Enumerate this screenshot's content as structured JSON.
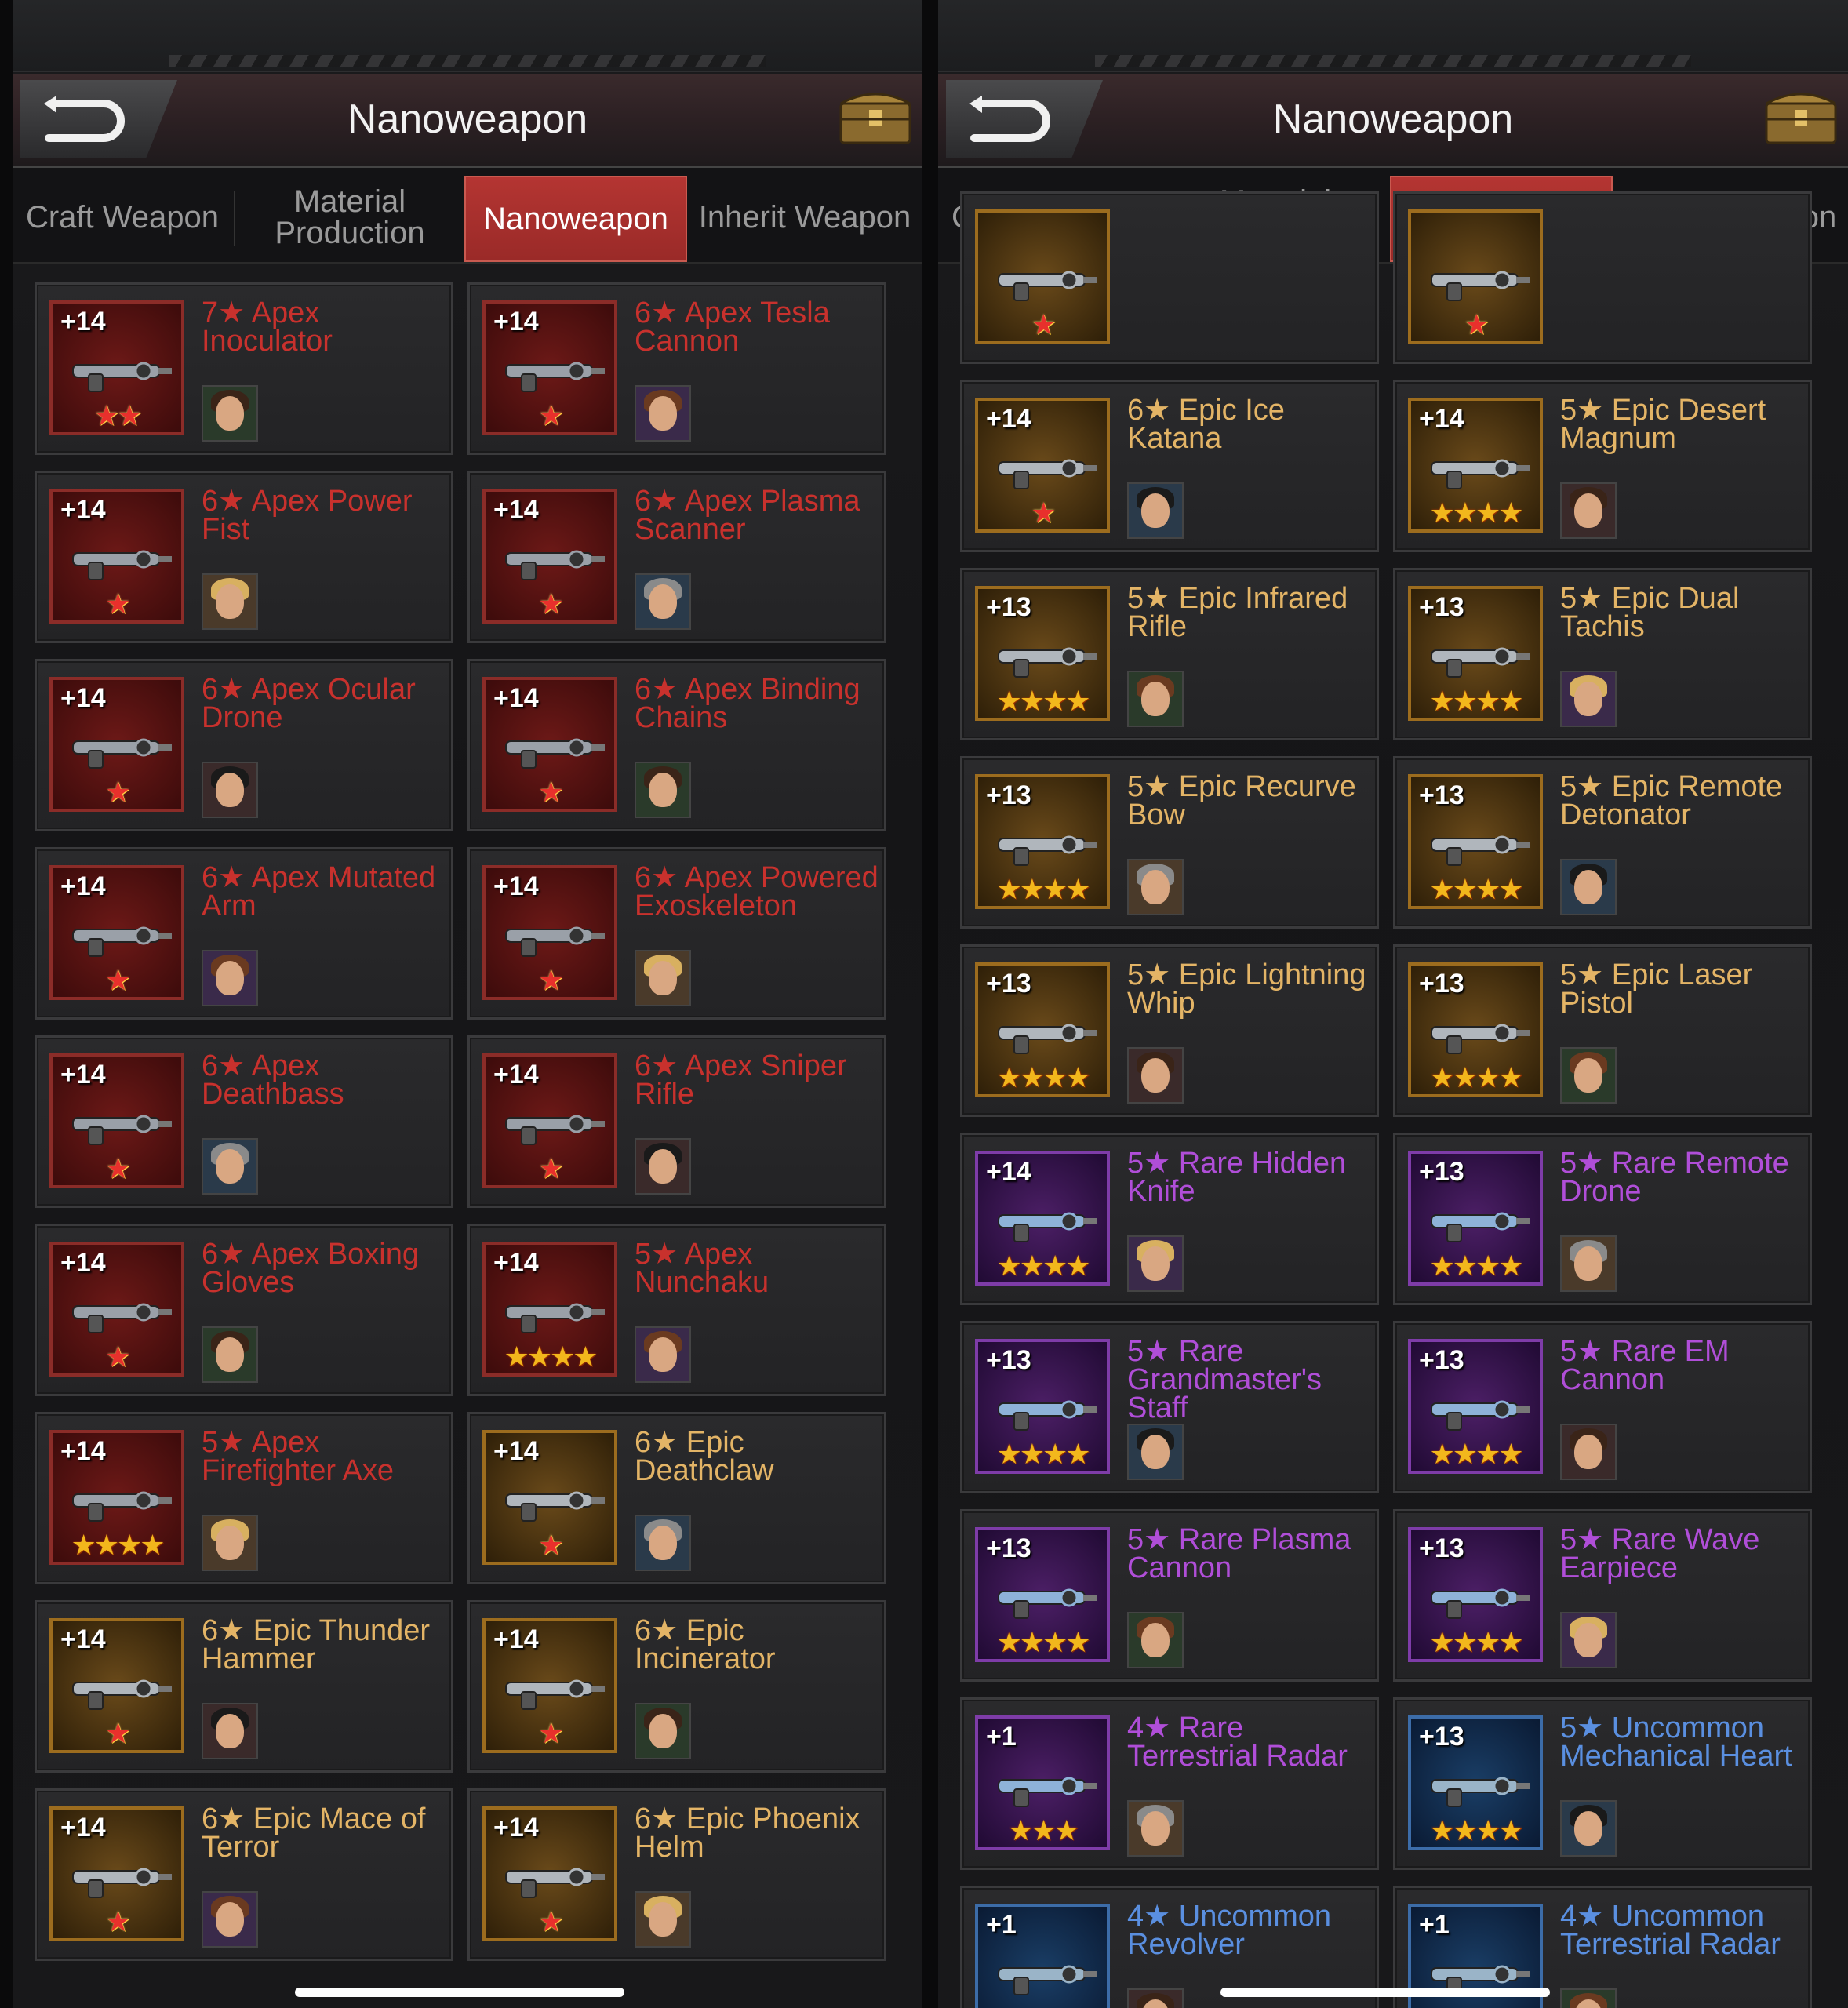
{
  "panels": [
    {
      "header": {
        "title": "Nanoweapon"
      },
      "tabs": [
        {
          "label": "Craft Weapon",
          "active": false
        },
        {
          "label": "Material Production",
          "active": false
        },
        {
          "label": "Nanoweapon",
          "active": true
        },
        {
          "label": "Inherit Weapon",
          "active": false
        }
      ],
      "items": [
        {
          "level": "+14",
          "name": "7★ Apex Inoculator",
          "stars": "★★",
          "rarity": "red",
          "star_color": "red",
          "weapon_icon": "rifle-icon"
        },
        {
          "level": "+14",
          "name": "6★ Apex Tesla Cannon",
          "stars": "★",
          "rarity": "red",
          "star_color": "red",
          "weapon_icon": "cannon-icon"
        },
        {
          "level": "+14",
          "name": "6★ Apex Power Fist",
          "stars": "★",
          "rarity": "red",
          "star_color": "red",
          "weapon_icon": "fist-icon"
        },
        {
          "level": "+14",
          "name": "6★ Apex Plasma Scanner",
          "stars": "★",
          "rarity": "red",
          "star_color": "red",
          "weapon_icon": "scanner-icon"
        },
        {
          "level": "+14",
          "name": "6★ Apex Ocular Drone",
          "stars": "★",
          "rarity": "red",
          "star_color": "red",
          "weapon_icon": "drone-icon"
        },
        {
          "level": "+14",
          "name": "6★ Apex Binding Chains",
          "stars": "★",
          "rarity": "red",
          "star_color": "red",
          "weapon_icon": "chains-icon"
        },
        {
          "level": "+14",
          "name": "6★ Apex Mutated Arm",
          "stars": "★",
          "rarity": "red",
          "star_color": "red",
          "weapon_icon": "arm-icon"
        },
        {
          "level": "+14",
          "name": "6★ Apex Powered Exoskeleton",
          "stars": "★",
          "rarity": "red",
          "star_color": "red",
          "weapon_icon": "exoskeleton-icon"
        },
        {
          "level": "+14",
          "name": "6★ Apex Deathbass",
          "stars": "★",
          "rarity": "red",
          "star_color": "red",
          "weapon_icon": "guitar-icon"
        },
        {
          "level": "+14",
          "name": "6★ Apex Sniper Rifle",
          "stars": "★",
          "rarity": "red",
          "star_color": "red",
          "weapon_icon": "sniper-icon"
        },
        {
          "level": "+14",
          "name": "6★ Apex Boxing Gloves",
          "stars": "★",
          "rarity": "red",
          "star_color": "red",
          "weapon_icon": "gloves-icon"
        },
        {
          "level": "+14",
          "name": "5★ Apex Nunchaku",
          "stars": "★★★★",
          "rarity": "red",
          "star_color": "gold",
          "weapon_icon": "nunchaku-icon"
        },
        {
          "level": "+14",
          "name": "5★ Apex Firefighter Axe",
          "stars": "★★★★",
          "rarity": "red",
          "star_color": "gold",
          "weapon_icon": "axe-icon"
        },
        {
          "level": "+14",
          "name": "6★ Epic Deathclaw",
          "stars": "★",
          "rarity": "gold",
          "star_color": "red",
          "weapon_icon": "claw-icon"
        },
        {
          "level": "+14",
          "name": "6★ Epic Thunder Hammer",
          "stars": "★",
          "rarity": "gold",
          "star_color": "red",
          "weapon_icon": "hammer-icon"
        },
        {
          "level": "+14",
          "name": "6★ Epic Incinerator",
          "stars": "★",
          "rarity": "gold",
          "star_color": "red",
          "weapon_icon": "incinerator-icon"
        },
        {
          "level": "+14",
          "name": "6★ Epic Mace of Terror",
          "stars": "★",
          "rarity": "gold",
          "star_color": "red",
          "weapon_icon": "mace-icon"
        },
        {
          "level": "+14",
          "name": "6★ Epic Phoenix Helm",
          "stars": "★",
          "rarity": "gold",
          "star_color": "red",
          "weapon_icon": "helm-icon"
        }
      ]
    },
    {
      "header": {
        "title": "Nanoweapon"
      },
      "tabs": [
        {
          "label": "Craft Weapon",
          "active": false
        },
        {
          "label": "Material Production",
          "active": false
        },
        {
          "label": "Nanoweapon",
          "active": true
        },
        {
          "label": "Inherit Weapon",
          "active": false
        }
      ],
      "items": [
        {
          "level": "",
          "name": "",
          "stars": "★",
          "rarity": "gold",
          "star_color": "red",
          "weapon_icon": "weapon-icon"
        },
        {
          "level": "",
          "name": "",
          "stars": "★",
          "rarity": "gold",
          "star_color": "red",
          "weapon_icon": "weapon-icon"
        },
        {
          "level": "+14",
          "name": "6★ Epic Ice Katana",
          "stars": "★",
          "rarity": "gold",
          "star_color": "red",
          "weapon_icon": "katana-icon"
        },
        {
          "level": "+14",
          "name": "5★ Epic Desert Magnum",
          "stars": "★★★★",
          "rarity": "gold",
          "star_color": "gold",
          "weapon_icon": "magnum-icon"
        },
        {
          "level": "+13",
          "name": "5★ Epic Infrared Rifle",
          "stars": "★★★★",
          "rarity": "gold",
          "star_color": "gold",
          "weapon_icon": "rifle-icon"
        },
        {
          "level": "+13",
          "name": "5★ Epic Dual Tachis",
          "stars": "★★★★",
          "rarity": "gold",
          "star_color": "gold",
          "weapon_icon": "swords-icon"
        },
        {
          "level": "+13",
          "name": "5★ Epic Recurve Bow",
          "stars": "★★★★",
          "rarity": "gold",
          "star_color": "gold",
          "weapon_icon": "bow-icon"
        },
        {
          "level": "+13",
          "name": "5★ Epic Remote Detonator",
          "stars": "★★★★",
          "rarity": "gold",
          "star_color": "gold",
          "weapon_icon": "detonator-icon"
        },
        {
          "level": "+13",
          "name": "5★ Epic Lightning Whip",
          "stars": "★★★★",
          "rarity": "gold",
          "star_color": "gold",
          "weapon_icon": "whip-icon"
        },
        {
          "level": "+13",
          "name": "5★ Epic Laser Pistol",
          "stars": "★★★★",
          "rarity": "gold",
          "star_color": "gold",
          "weapon_icon": "pistol-icon"
        },
        {
          "level": "+14",
          "name": "5★ Rare Hidden Knife",
          "stars": "★★★★",
          "rarity": "purple",
          "star_color": "gold",
          "weapon_icon": "knife-icon"
        },
        {
          "level": "+13",
          "name": "5★ Rare Remote Drone",
          "stars": "★★★★",
          "rarity": "purple",
          "star_color": "gold",
          "weapon_icon": "drone-icon"
        },
        {
          "level": "+13",
          "name": "5★ Rare Grandmaster's Staff",
          "stars": "★★★★",
          "rarity": "purple",
          "star_color": "gold",
          "weapon_icon": "staff-icon"
        },
        {
          "level": "+13",
          "name": "5★ Rare EM Cannon",
          "stars": "★★★★",
          "rarity": "purple",
          "star_color": "gold",
          "weapon_icon": "cannon-icon"
        },
        {
          "level": "+13",
          "name": "5★ Rare Plasma Cannon",
          "stars": "★★★★",
          "rarity": "purple",
          "star_color": "gold",
          "weapon_icon": "plasma-cannon-icon"
        },
        {
          "level": "+13",
          "name": "5★ Rare Wave Earpiece",
          "stars": "★★★★",
          "rarity": "purple",
          "star_color": "gold",
          "weapon_icon": "headset-icon"
        },
        {
          "level": "+1",
          "name": "4★ Rare Terrestrial Radar",
          "stars": "★★★",
          "rarity": "purple",
          "star_color": "gold",
          "weapon_icon": "radar-icon"
        },
        {
          "level": "+13",
          "name": "5★ Uncommon Mechanical Heart",
          "stars": "★★★★",
          "rarity": "blue",
          "star_color": "gold",
          "weapon_icon": "heart-icon"
        },
        {
          "level": "+1",
          "name": "4★ Uncommon Revolver",
          "stars": "",
          "rarity": "blue",
          "star_color": "gold",
          "weapon_icon": "revolver-icon"
        },
        {
          "level": "+1",
          "name": "4★ Uncommon Terrestrial Radar",
          "stars": "",
          "rarity": "blue",
          "star_color": "gold",
          "weapon_icon": "radar-icon"
        }
      ]
    }
  ],
  "colors": {
    "apex": "#c8312d",
    "epic": "#e3b466",
    "rare": "#b04ed8",
    "uncommon": "#5a8fe0",
    "tab_active": "#b43532"
  }
}
